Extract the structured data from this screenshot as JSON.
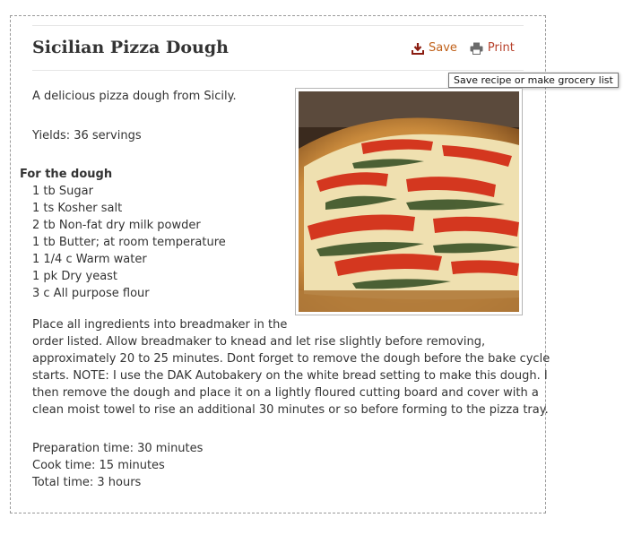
{
  "recipe": {
    "title": "Sicilian Pizza Dough",
    "description": "A delicious pizza dough from Sicily.",
    "yields": "Yields: 36 servings",
    "ingredient_section": "For the dough",
    "ingredients": [
      "1 tb Sugar",
      "1 ts Kosher salt",
      "2 tb Non-fat dry milk powder",
      "1 tb Butter; at room temperature",
      "1 1/4 c Warm water",
      "1 pk Dry yeast",
      "3 c All purpose flour"
    ],
    "instruction_lines": [
      "Place all ingredients into breadmaker in the",
      "order listed. Allow breadmaker to knead and let rise slightly before removing,",
      "approximately 20 to 25 minutes. Dont forget to remove the dough before the bake cycle",
      "starts. NOTE: I use the DAK Autobakery on the white bread setting to make this dough. I",
      "then remove the dough and place it on a lightly floured cutting board and cover with a",
      "clean moist towel to rise an additional 30 minutes or so before forming to the pizza tray."
    ],
    "prep_time": "Preparation time: 30 minutes",
    "cook_time": "Cook time: 15 minutes",
    "total_time": "Total time: 3 hours"
  },
  "actions": {
    "save_label": "Save",
    "save_icon": "download-icon",
    "print_label": "Print",
    "print_icon": "printer-icon",
    "save_color": "#c0611a",
    "print_color": "#b7412b"
  },
  "tooltip": {
    "text": "Save recipe or make grocery list"
  }
}
